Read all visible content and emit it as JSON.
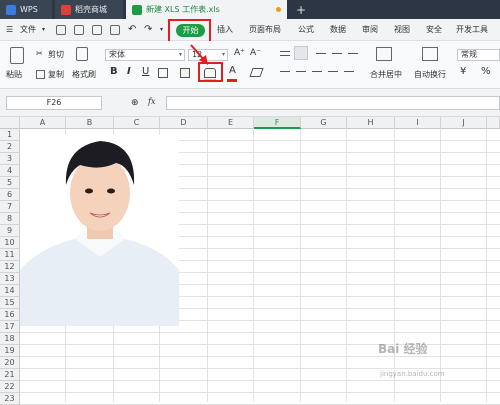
{
  "titlebar": {
    "tabs": [
      {
        "label": "WPS"
      },
      {
        "label": "稻壳商城"
      },
      {
        "label": "新建 XLS 工作表.xls"
      }
    ],
    "plus": "+"
  },
  "menubar": {
    "file": "文件",
    "start": "开始",
    "items": [
      "插入",
      "页面布局",
      "公式",
      "数据",
      "审阅",
      "视图",
      "安全",
      "开发工具"
    ]
  },
  "ribbon": {
    "paste": "粘贴",
    "cut": "剪切",
    "copy": "复制",
    "format_painter": "格式刷",
    "font_name": "宋体",
    "font_size": "12",
    "bold": "B",
    "italic": "I",
    "underline": "U",
    "font_color": "A",
    "grow_font": "A⁺",
    "shrink_font": "A⁻",
    "merge_center": "合并居中",
    "wrap_text": "自动换行",
    "number_format": "常规",
    "percent": "%",
    "currency": "¥"
  },
  "formula_bar": {
    "cell_ref": "F26",
    "fx": "fx"
  },
  "grid": {
    "columns": [
      "A",
      "B",
      "C",
      "D",
      "E",
      "F",
      "G",
      "H",
      "I",
      "J"
    ],
    "rows": [
      "1",
      "2",
      "3",
      "4",
      "5",
      "6",
      "7",
      "8",
      "9",
      "10",
      "11",
      "12",
      "13",
      "14",
      "15",
      "16",
      "17",
      "18",
      "19",
      "20",
      "21",
      "22",
      "23"
    ],
    "selected_column": "F"
  },
  "watermark": "Bai 经验",
  "watermark_sub": "jingyan.baidu.com",
  "colors": {
    "accent": "#1e9b45",
    "annotation": "#e02020",
    "titlebar": "#2c3644"
  }
}
